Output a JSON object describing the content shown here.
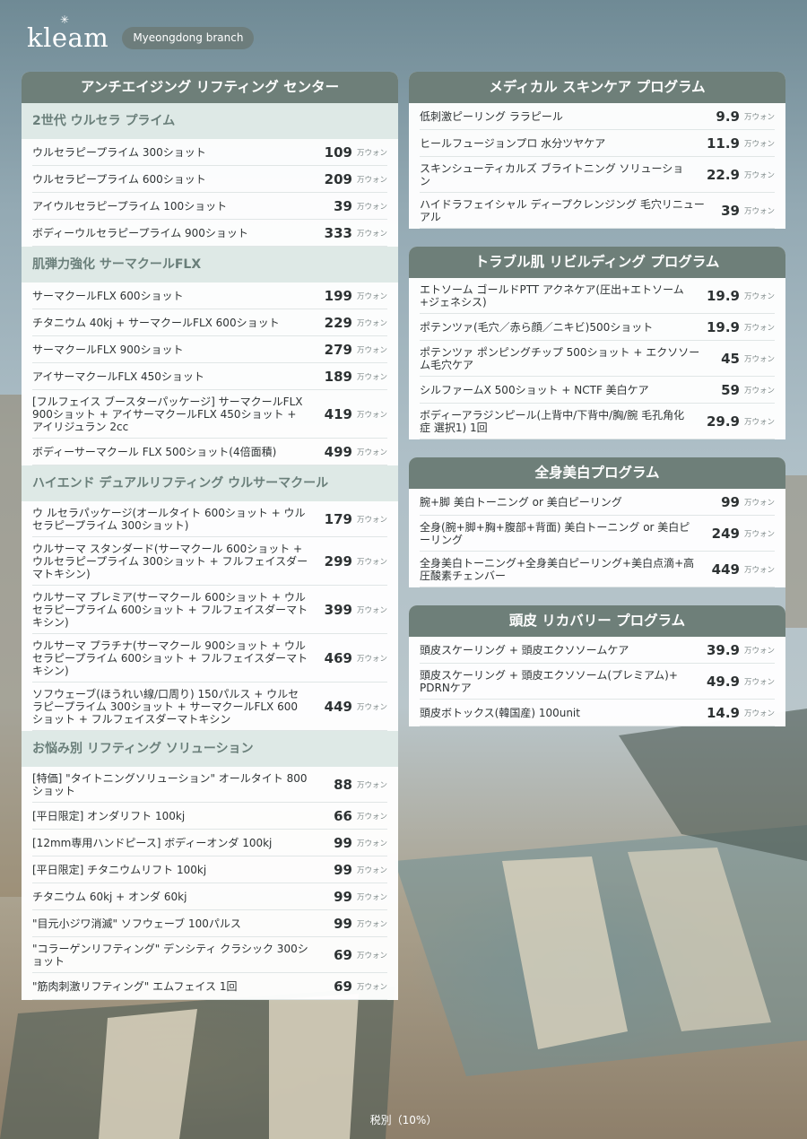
{
  "header": {
    "logo": "kleam",
    "branch": "Myeongdong branch"
  },
  "unit": "万ウォン",
  "footer": "税別（10%）",
  "left": {
    "title": "アンチエイジング リフティング センター",
    "sections": [
      {
        "heading": "2世代 ウルセラ プライム",
        "items": [
          {
            "name": "ウルセラピープライム 300ショット",
            "price": "109"
          },
          {
            "name": "ウルセラピープライム 600ショット",
            "price": "209"
          },
          {
            "name": "アイウルセラピープライム 100ショット",
            "price": "39"
          },
          {
            "name": "ボディーウルセラピープライム 900ショット",
            "price": "333"
          }
        ]
      },
      {
        "heading": "肌弾力強化 サーマクールFLX",
        "items": [
          {
            "name": "サーマクールFLX 600ショット",
            "price": "199"
          },
          {
            "name": "チタニウム 40kj + サーマクールFLX 600ショット",
            "price": "229"
          },
          {
            "name": "サーマクールFLX 900ショット",
            "price": "279"
          },
          {
            "name": "アイサーマクールFLX 450ショット",
            "price": "189"
          },
          {
            "name": "[フルフェイス ブースターパッケージ] サーマクールFLX 900ショット + アイサーマクールFLX 450ショット + アイリジュラン 2cc",
            "price": "419"
          },
          {
            "name": "ボディーサーマクール FLX 500ショット(4倍面積)",
            "price": "499"
          }
        ]
      },
      {
        "heading": "ハイエンド デュアルリフティング ウルサーマクール",
        "items": [
          {
            "name": "ウ ルセラパッケージ(オールタイト 600ショット + ウルセラピープライム 300ショット)",
            "price": "179"
          },
          {
            "name": "ウルサーマ スタンダード(サーマクール 600ショット + ウルセラピープライム 300ショット + フルフェイスダーマトキシン)",
            "price": "299"
          },
          {
            "name": "ウルサーマ プレミア(サーマクール 600ショット + ウルセラピープライム 600ショット + フルフェイスダーマトキシン)",
            "price": "399"
          },
          {
            "name": "ウルサーマ プラチナ(サーマクール 900ショット + ウルセラピープライム 600ショット + フルフェイスダーマトキシン)",
            "price": "469"
          },
          {
            "name": "ソフウェーブ(ほうれい線/口周り) 150パルス + ウルセラピープライム 300ショット + サーマクールFLX 600ショット + フルフェイスダーマトキシン",
            "price": "449"
          }
        ]
      },
      {
        "heading": "お悩み別 リフティング ソリューション",
        "items": [
          {
            "name": "[特価] \"タイトニングソリューション\" オールタイト 800ショット",
            "price": "88"
          },
          {
            "name": "[平日限定] オンダリフト 100kj",
            "price": "66"
          },
          {
            "name": "[12mm専用ハンドピース] ボディーオンダ 100kj",
            "price": "99"
          },
          {
            "name": "[平日限定] チタニウムリフト 100kj",
            "price": "99"
          },
          {
            "name": "チタニウム 60kj + オンダ 60kj",
            "price": "99"
          },
          {
            "name": "\"目元小ジワ消滅\" ソフウェーブ 100パルス",
            "price": "99"
          },
          {
            "name": "\"コラーゲンリフティング\" デンシティ クラシック 300ショット",
            "price": "69"
          },
          {
            "name": "\"筋肉刺激リフティング\" エムフェイス 1回",
            "price": "69"
          }
        ]
      }
    ]
  },
  "right": [
    {
      "title": "メディカル スキンケア プログラム",
      "items": [
        {
          "name": "低刺激ピーリング ララピール",
          "price": "9.9"
        },
        {
          "name": "ヒールフュージョンプロ 水分ツヤケア",
          "price": "11.9"
        },
        {
          "name": "スキンシューティカルズ ブライトニング ソリューション",
          "price": "22.9"
        },
        {
          "name": "ハイドラフェイシャル ディープクレンジング 毛穴リニューアル",
          "price": "39"
        }
      ]
    },
    {
      "title": "トラブル肌 リビルディング プログラム",
      "items": [
        {
          "name": "エトソーム ゴールドPTT アクネケア(圧出+エトソーム+ジェネシス)",
          "price": "19.9"
        },
        {
          "name": "ポテンツァ(毛穴／赤ら顔／ニキビ)500ショット",
          "price": "19.9"
        },
        {
          "name": "ポテンツァ ポンピングチップ 500ショット + エクソソーム毛穴ケア",
          "price": "45"
        },
        {
          "name": "シルファームX 500ショット + NCTF 美白ケア",
          "price": "59"
        },
        {
          "name": "ボディーアラジンピール(上背中/下背中/胸/腕 毛孔角化症 選択1) 1回",
          "price": "29.9"
        }
      ]
    },
    {
      "title": "全身美白プログラム",
      "items": [
        {
          "name": "腕+脚 美白トーニング or 美白ピーリング",
          "price": "99"
        },
        {
          "name": "全身(腕+脚+胸+腹部+背面) 美白トーニング or 美白ピーリング",
          "price": "249"
        },
        {
          "name": "全身美白トーニング+全身美白ピーリング+美白点滴+高圧酸素チェンバー",
          "price": "449"
        }
      ]
    },
    {
      "title": "頭皮 リカバリー プログラム",
      "items": [
        {
          "name": "頭皮スケーリング + 頭皮エクソソームケア",
          "price": "39.9"
        },
        {
          "name": "頭皮スケーリング + 頭皮エクソソーム(プレミアム)+ PDRNケア",
          "price": "49.9"
        },
        {
          "name": "頭皮ボトックス(韓国産) 100unit",
          "price": "14.9"
        }
      ]
    }
  ]
}
